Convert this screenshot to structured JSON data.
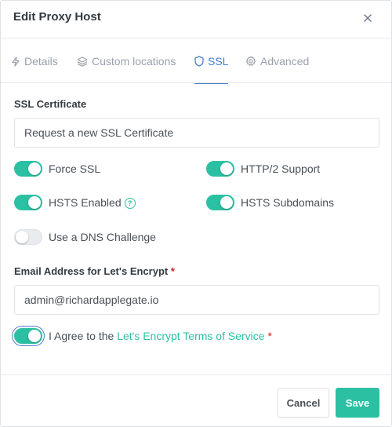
{
  "modal": {
    "title": "Edit Proxy Host",
    "close_icon": "close-icon"
  },
  "tabs": [
    {
      "label": "Details",
      "icon": "lightning-icon",
      "active": false
    },
    {
      "label": "Custom locations",
      "icon": "layers-icon",
      "active": false
    },
    {
      "label": "SSL",
      "icon": "shield-icon",
      "active": true
    },
    {
      "label": "Advanced",
      "icon": "gear-icon",
      "active": false
    }
  ],
  "ssl": {
    "certificate_label": "SSL Certificate",
    "certificate_value": "Request a new SSL Certificate",
    "toggles": {
      "force_ssl": {
        "label": "Force SSL",
        "on": true
      },
      "http2": {
        "label": "HTTP/2 Support",
        "on": true
      },
      "hsts": {
        "label": "HSTS Enabled",
        "on": true,
        "help": "?"
      },
      "hsts_subdomains": {
        "label": "HSTS Subdomains",
        "on": true
      },
      "dns_challenge": {
        "label": "Use a DNS Challenge",
        "on": false
      }
    },
    "email_label": "Email Address for Let's Encrypt",
    "required_mark": "*",
    "email_value": "admin@richardapplegate.io",
    "agree_prefix": "I Agree to the ",
    "agree_link": "Let's Encrypt Terms of Service",
    "agree_on": true
  },
  "footer": {
    "cancel_label": "Cancel",
    "save_label": "Save"
  },
  "colors": {
    "accent": "#2cc0a3",
    "active_tab": "#467fcf",
    "required": "#cd201f"
  }
}
